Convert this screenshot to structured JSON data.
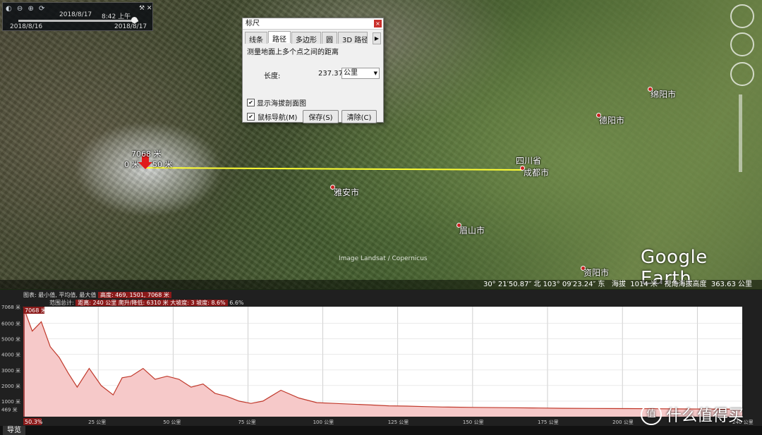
{
  "timebar": {
    "icons": "◐ ⊖ ⊕ ⟳",
    "date": "2018/8/17",
    "time": "8:42 上午",
    "start": "2018/8/16",
    "end": "2018/8/17",
    "tool_icon": "⚒ ✕"
  },
  "map_labels": {
    "peak": "7068 米",
    "peak_left": "0 米",
    "peak_right": "50 米",
    "province": "四川省",
    "cities": [
      "成都市",
      "雅安市",
      "眉山市",
      "德阳市",
      "绵阳市",
      "资阳市"
    ]
  },
  "ruler": {
    "title": "标尺",
    "close": "×",
    "tabs": [
      "线条",
      "路径",
      "多边形",
      "圆",
      "3D 路径"
    ],
    "active_tab": 1,
    "description": "测量地面上多个点之间的距离",
    "length_label": "长度:",
    "length_value": "237.37",
    "unit": "公里",
    "show_profile": "显示海拔剖面图",
    "mouse_nav": "鼠标导航(M)",
    "save": "保存(S)",
    "clear": "清除(C)"
  },
  "credit": "Image Landsat / Copernicus",
  "brand": "Google Earth",
  "status": {
    "coords": "30° 21′50.87″ 北 103° 09′23.24″ 东",
    "elev_label": "海拔",
    "elev_value": "1014 米",
    "eye_label": "视角海拔高度",
    "eye_value": "363.63 公里"
  },
  "profile_stats": {
    "line1_prefix": "图表: 最小值, 平均值, 最大值",
    "line1_values": "高度: 469, 1501, 7068 米",
    "line2_prefix": "范围总计:",
    "line2_values": "距离: 240 公里 爬升/降低: 6310 米 大坡度: 3 坡度: 8.6%",
    "line2_tail": "6.6%",
    "marker_top": "7068 米",
    "marker_bottom": "50.3%"
  },
  "bottom": {
    "nav_tab": "导览"
  },
  "watermark": "值 什么值得买",
  "colors": {
    "profile_fill": "#f6c9c9",
    "profile_line": "#c0392b",
    "path_line": "#ffff33"
  },
  "chart_data": {
    "type": "area",
    "x": [
      0,
      3,
      6,
      9,
      12,
      15,
      18,
      22,
      26,
      30,
      33,
      36,
      40,
      44,
      48,
      52,
      56,
      60,
      64,
      68,
      72,
      76,
      80,
      86,
      92,
      98,
      104,
      110,
      116,
      122,
      128,
      134,
      140,
      150,
      160,
      170,
      180,
      190,
      200,
      210,
      220,
      230,
      240
    ],
    "y": [
      7068,
      5500,
      6100,
      4500,
      3800,
      2800,
      1900,
      3100,
      2000,
      1400,
      2500,
      2600,
      3100,
      2400,
      2600,
      2400,
      1900,
      2100,
      1500,
      1300,
      1000,
      850,
      1000,
      1700,
      1200,
      900,
      850,
      800,
      750,
      700,
      680,
      650,
      620,
      600,
      580,
      560,
      540,
      530,
      520,
      510,
      500,
      490,
      480
    ],
    "ylim": [
      0,
      7068
    ],
    "xlim": [
      0,
      240
    ],
    "yticks": [
      "7068 米",
      "6000 米",
      "5000 米",
      "4000 米",
      "3000 米",
      "2000 米",
      "1000 米",
      "469 米"
    ],
    "xticks": [
      "25 公里",
      "50 公里",
      "75 公里",
      "100 公里",
      "125 公里",
      "150 公里",
      "175 公里",
      "200 公里",
      "240 公里"
    ],
    "grid": true
  }
}
